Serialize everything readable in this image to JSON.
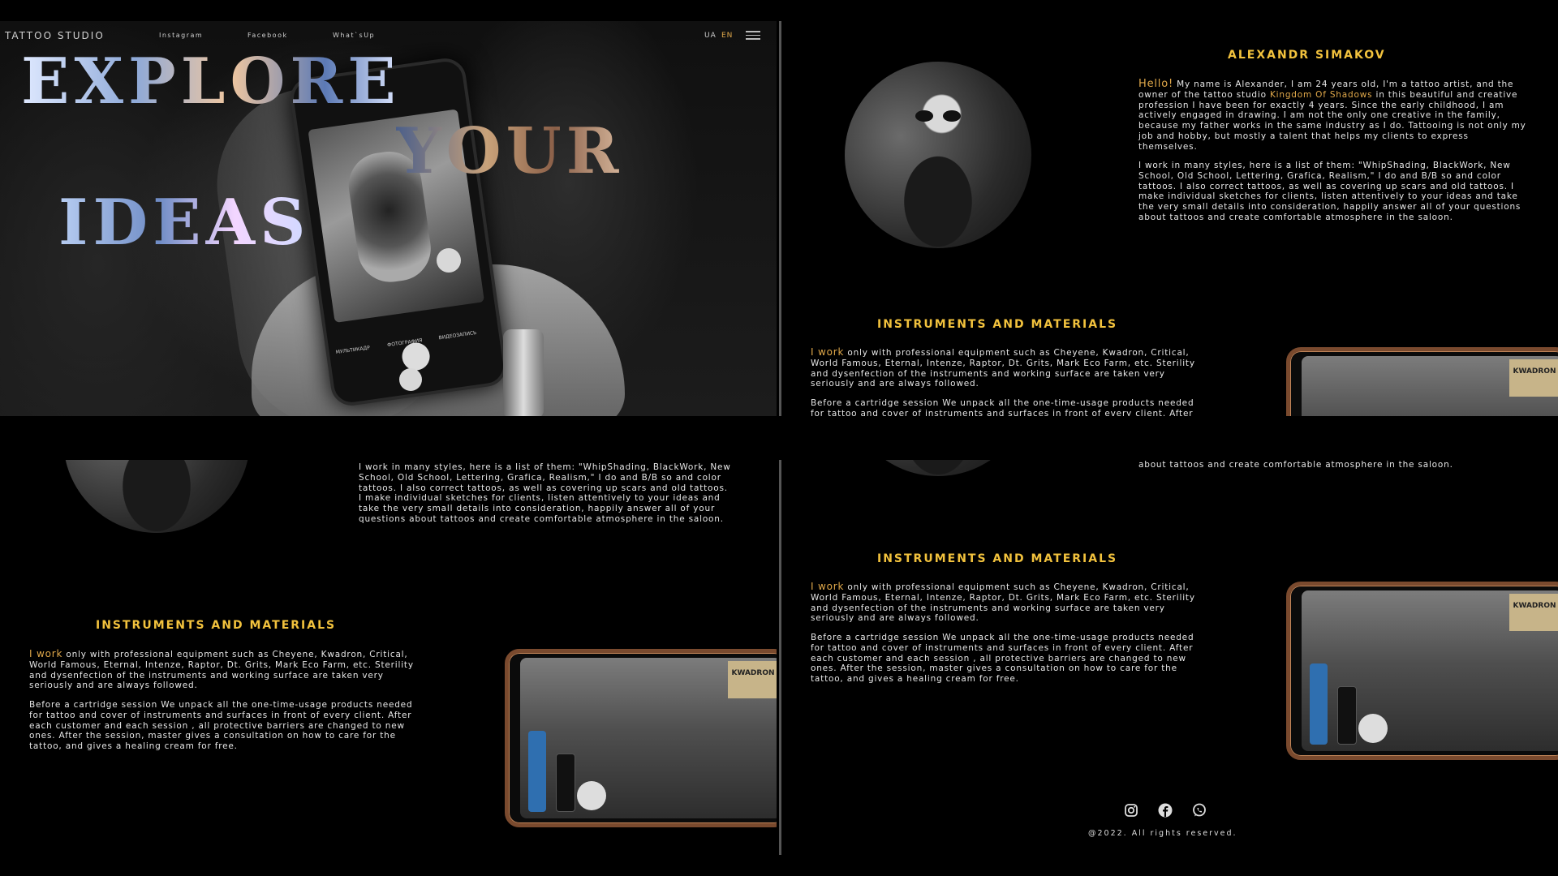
{
  "nav": {
    "brand": "TATTOO STUDIO",
    "links": [
      "Instagram",
      "Facebook",
      "What`sUp"
    ],
    "lang_ua": "UA",
    "lang_en": "EN"
  },
  "hero": {
    "words": [
      "EXPLORE",
      "YOUR",
      "IDEAS"
    ],
    "camera_modes": [
      "МУЛЬТИКАДР",
      "ФОТОГРАФИЯ",
      "ВИДЕОЗАПИСЬ"
    ]
  },
  "about": {
    "name": "ALEXANDR SIMAKOV",
    "hello": "Hello!",
    "p1_a": " My name is Alexander, I am 24 years old, I'm a tattoo artist, and the owner of the tattoo studio ",
    "studio": "Kingdom Of Shadows",
    "p1_b": " in this beautiful and creative profession I have been for exactly 4 years. Since the early childhood, I am actively engaged in drawing. I am not the only one creative in the family, because my father works in the same industry as I do. Tattooing is not only my job and hobby, but mostly a talent that helps my clients to express themselves.",
    "p2": "I work in many styles, here is a list of them: \"WhipShading, BlackWork, New School, Old School, Lettering, Grafica, Realism,\" I do and B/B so and color tattoos. I also correct tattoos, as well as covering up scars and old tattoos. I make individual sketches for clients, listen attentively to your ideas and take the very small details into consideration, happily answer all of your questions about tattoos and create comfortable atmosphere in the saloon.",
    "p2_tail": "about tattoos and create comfortable atmosphere in the saloon."
  },
  "instruments": {
    "title": "INSTRUMENTS AND MATERIALS",
    "i_work": "I work",
    "p1": " only with professional equipment such as Cheyene, Kwadron, Critical, World Famous, Eternal, Intenze, Raptor, Dt. Grits, Mark Eco Farm, etc. Sterility and dysenfection of the instruments and working surface are taken very seriously and are always followed.",
    "p2": "Before a cartridge session We unpack all the one-time-usage products needed for tattoo and cover of instruments and surfaces in front of every client. After each customer and each session , all protective barriers are changed to new ones. After the session, master gives a consultation on how to care for the tattoo, and gives a healing cream for free.",
    "kwadron_label": "KWADRON"
  },
  "footer": {
    "copyright": "@2022. All rights reserved.",
    "icons": [
      "instagram-icon",
      "facebook-icon",
      "whatsapp-icon"
    ]
  },
  "colors": {
    "accent": "#f2c23d",
    "highlight": "#e0a84a",
    "background": "#000000"
  }
}
